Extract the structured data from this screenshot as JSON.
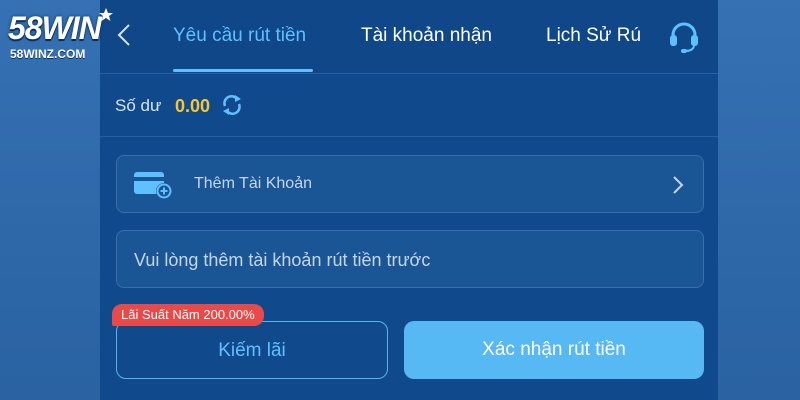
{
  "logo": {
    "brand": "58WIN",
    "domain": "58WINZ.COM"
  },
  "header": {
    "tabs": [
      {
        "label": "Yêu cầu rút tiền",
        "active": true
      },
      {
        "label": "Tài khoản nhận",
        "active": false
      },
      {
        "label": "Lịch Sử Rú",
        "active": false
      }
    ],
    "support_icon": "headset-icon",
    "back_icon": "chevron-left-icon"
  },
  "balance": {
    "label": "Số dư",
    "value": "0.00",
    "refresh_icon": "refresh-icon"
  },
  "add_account": {
    "label": "Thêm Tài Khoản",
    "icon": "wallet-add-icon",
    "chevron_icon": "chevron-right-icon"
  },
  "notice": {
    "text": "Vui lòng thêm tài khoản rút tiền trước"
  },
  "actions": {
    "rate_badge": "Lãi Suất Năm 200.00%",
    "interest_label": "Kiếm lãi",
    "confirm_label": "Xác nhận rút tiền"
  },
  "colors": {
    "panel": "#114a8c",
    "accent": "#5fc0ff",
    "balance": "#f7c531",
    "badge": "#e84a4a",
    "confirm": "#57b9f4"
  }
}
